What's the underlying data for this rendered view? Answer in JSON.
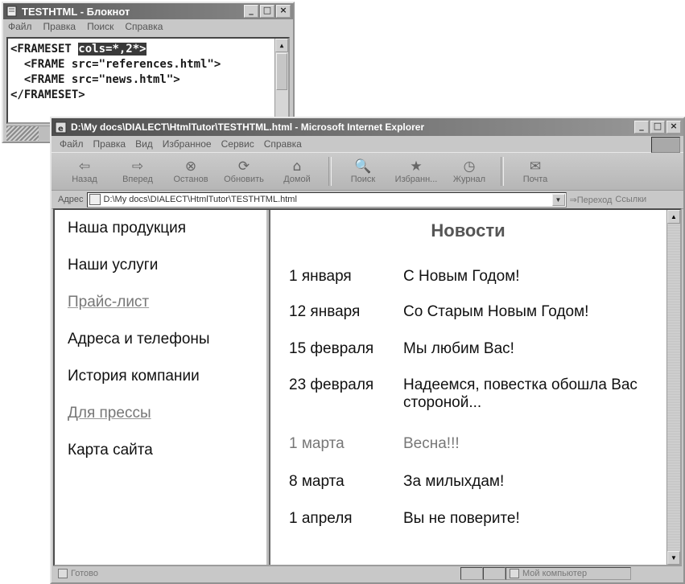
{
  "notepad": {
    "title": "TESTHTML - Блокнот",
    "menu": [
      "Файл",
      "Правка",
      "Поиск",
      "Справка"
    ],
    "lines": [
      {
        "pre": "<FRAMESET ",
        "hl": "cols=*,2*>",
        "post": ""
      },
      {
        "pre": "  <FRAME src=\"references.html\">",
        "hl": "",
        "post": ""
      },
      {
        "pre": "  <FRAME src=\"news.html\">",
        "hl": "",
        "post": ""
      },
      {
        "pre": "</FRAMESET>",
        "hl": "",
        "post": ""
      }
    ]
  },
  "ie": {
    "title": "D:\\My docs\\DIALECT\\HtmlTutor\\TESTHTML.html - Microsoft Internet Explorer",
    "menu": [
      "Файл",
      "Правка",
      "Вид",
      "Избранное",
      "Сервис",
      "Справка"
    ],
    "toolbar": [
      {
        "glyph": "⇦",
        "label": "Назад"
      },
      {
        "glyph": "⇨",
        "label": "Вперед"
      },
      {
        "glyph": "⊗",
        "label": "Останов"
      },
      {
        "glyph": "⟳",
        "label": "Обновить"
      },
      {
        "glyph": "⌂",
        "label": "Домой"
      },
      {
        "glyph": "🔍",
        "label": "Поиск"
      },
      {
        "glyph": "★",
        "label": "Избранн..."
      },
      {
        "glyph": "◷",
        "label": "Журнал"
      },
      {
        "glyph": "✉",
        "label": "Почта"
      }
    ],
    "address_label": "Адрес",
    "address_value": "D:\\My docs\\DIALECT\\HtmlTutor\\TESTHTML.html",
    "go_label": "Переход",
    "links_label": "Ссылки",
    "status_ready": "Готово",
    "status_zone": "Мой компьютер"
  },
  "left_frame": {
    "items": [
      {
        "label": "Наша продукция",
        "link": false
      },
      {
        "label": "Наши услуги",
        "link": false
      },
      {
        "label": "Прайс-лист",
        "link": true
      },
      {
        "label": "Адреса и телефоны",
        "link": false
      },
      {
        "label": "История компании",
        "link": false
      },
      {
        "label": "Для прессы",
        "link": true
      },
      {
        "label": "Карта сайта",
        "link": false
      }
    ]
  },
  "right_frame": {
    "title": "Новости",
    "news": [
      {
        "date": "1 января",
        "text": "С Новым Годом!",
        "muted": false
      },
      {
        "date": "12 января",
        "text": "Со Старым Новым Годом!",
        "muted": false
      },
      {
        "date": "15 февраля",
        "text": "Мы любим Вас!",
        "muted": false
      },
      {
        "date": "23 февраля",
        "text": "Надеемся, повестка обошла Вас стороной...",
        "muted": false
      },
      {
        "date": "1 марта",
        "text": "Весна!!!",
        "muted": true
      },
      {
        "date": "8 марта",
        "text": "За милыхдам!",
        "muted": false
      },
      {
        "date": "1 апреля",
        "text": "Вы не поверите!",
        "muted": false
      }
    ]
  }
}
